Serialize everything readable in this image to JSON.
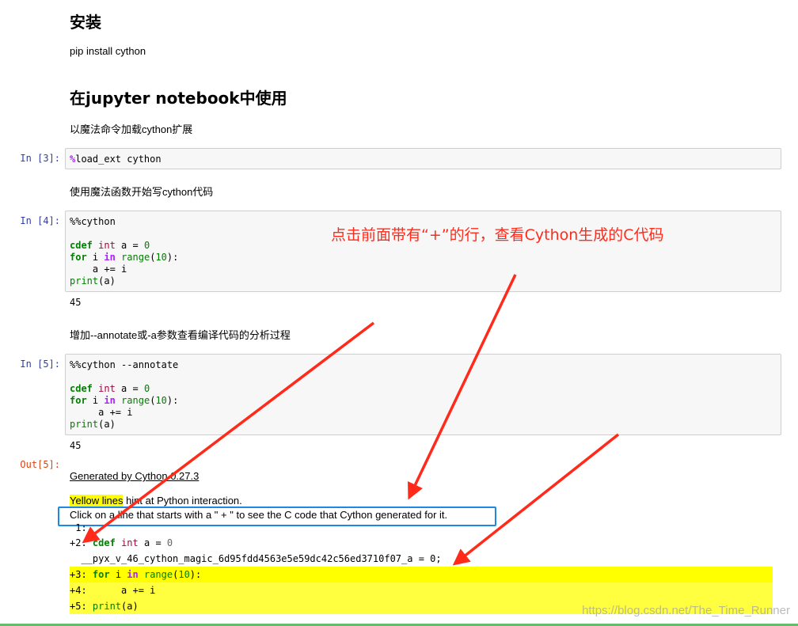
{
  "sections": {
    "install_heading": "安装",
    "install_text": "pip install cython",
    "jupyter_heading": "在jupyter notebook中使用",
    "load_text": "以魔法命令加载cython扩展",
    "magic_text": "使用魔法函数开始写cython代码",
    "annotate_text": "增加--annotate或-a参数查看编译代码的分析过程"
  },
  "cells": [
    {
      "prompt": "In  [3]:",
      "lines": [
        "%load_ext cython"
      ]
    },
    {
      "prompt": "In  [4]:",
      "lines": [
        "%%cython",
        "",
        "cdef int a = 0",
        "for i in range(10):",
        "    a += i",
        "print(a)"
      ],
      "output": "45"
    },
    {
      "prompt": "In  [5]:",
      "lines": [
        "%%cython --annotate",
        "",
        "cdef int a = 0",
        "for i in range(10):",
        "     a += i",
        "print(a)"
      ],
      "output": "45"
    }
  ],
  "out_prompt": "Out[5]:",
  "annotation": {
    "generated_by": "Generated by Cython 0.27.3",
    "yellow_lines": "Yellow lines",
    "hint_rest": " hint at Python interaction.",
    "click_text": "Click on a line that starts with a \" + \" to see the C code that Cython generated for it.",
    "lines": [
      {
        "prefix": " 1:",
        "code": "",
        "bg": "none"
      },
      {
        "prefix": "+2:",
        "code": " cdef int a = 0",
        "bg": "none"
      },
      {
        "prefix": "",
        "code": "  __pyx_v_46_cython_magic_6d95fdd4563e5e59dc42c56ed3710f07_a = 0;",
        "bg": "none"
      },
      {
        "prefix": "+3:",
        "code": " for i in range(10):",
        "bg": "yellow"
      },
      {
        "prefix": "+4:",
        "code": "     a += i",
        "bg": "yellow"
      },
      {
        "prefix": "+5:",
        "code": " print(a)",
        "bg": "yellow"
      }
    ]
  },
  "callout": "点击前面带有“+”的行，查看Cython生成的C代码",
  "watermark": "https://blog.csdn.net/The_Time_Runner",
  "colors": {
    "arrow": "#ff2a1a",
    "callout": "#ff2a1a",
    "highlight_box": "#1e88e5",
    "yellow": "#ffff00"
  }
}
